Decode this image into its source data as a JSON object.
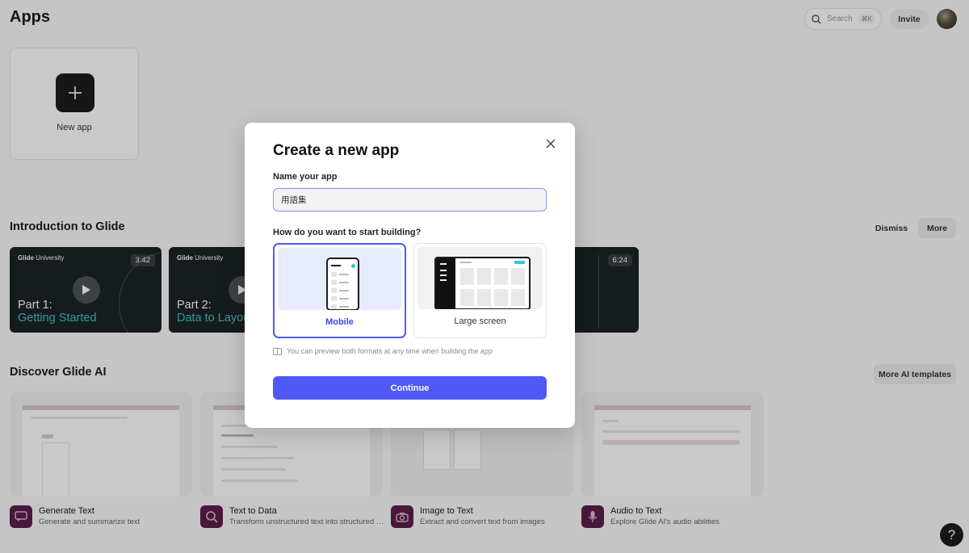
{
  "header": {
    "title": "Apps",
    "search_placeholder": "Search",
    "search_shortcut": "⌘K",
    "invite_label": "Invite"
  },
  "new_app": {
    "label": "New app"
  },
  "intro": {
    "title": "Introduction to Glide",
    "dismiss_label": "Dismiss",
    "more_label": "More",
    "brand_bold": "Glide",
    "brand_rest": " University",
    "videos": [
      {
        "duration": "3:42",
        "part": "Part 1:",
        "subtitle": "Getting Started"
      },
      {
        "duration": "",
        "part": "Part 2:",
        "subtitle": "Data to Layout"
      },
      {
        "duration": "6:24",
        "part": "",
        "subtitle": ""
      }
    ]
  },
  "ai": {
    "title": "Discover Glide AI",
    "more_templates_label": "More AI templates",
    "cards": [
      {
        "title": "Generate Text",
        "desc": "Generate and summarize text",
        "icon": "chat-icon"
      },
      {
        "title": "Text to Data",
        "desc": "Transform unstructured text into structured data",
        "icon": "magnifier-icon"
      },
      {
        "title": "Image to Text",
        "desc": "Extract and convert text from images",
        "icon": "camera-icon"
      },
      {
        "title": "Audio to Text",
        "desc": "Explore Glide AI's audio abilities",
        "icon": "microphone-icon"
      }
    ]
  },
  "help_label": "?",
  "modal": {
    "title": "Create a new app",
    "name_label": "Name your app",
    "name_value": "用語集",
    "build_label": "How do you want to start building?",
    "options": [
      {
        "label": "Mobile",
        "selected": true
      },
      {
        "label": "Large screen",
        "selected": false
      }
    ],
    "hint": "You can preview both formats at any time when building the app",
    "continue_label": "Continue"
  },
  "colors": {
    "accent": "#5059f5",
    "teal": "#3ec4d8",
    "ai_icon_bg": "#5b1f49"
  }
}
